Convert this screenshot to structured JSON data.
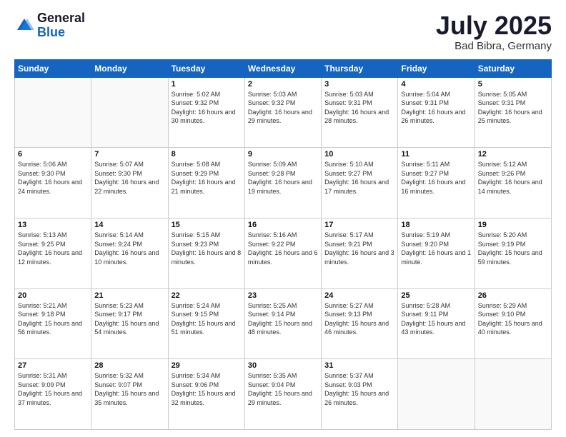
{
  "header": {
    "logo_general": "General",
    "logo_blue": "Blue",
    "main_title": "July 2025",
    "subtitle": "Bad Bibra, Germany"
  },
  "calendar": {
    "days_of_week": [
      "Sunday",
      "Monday",
      "Tuesday",
      "Wednesday",
      "Thursday",
      "Friday",
      "Saturday"
    ],
    "weeks": [
      [
        {
          "day": "",
          "info": ""
        },
        {
          "day": "",
          "info": ""
        },
        {
          "day": "1",
          "info": "Sunrise: 5:02 AM\nSunset: 9:32 PM\nDaylight: 16 hours and 30 minutes."
        },
        {
          "day": "2",
          "info": "Sunrise: 5:03 AM\nSunset: 9:32 PM\nDaylight: 16 hours and 29 minutes."
        },
        {
          "day": "3",
          "info": "Sunrise: 5:03 AM\nSunset: 9:31 PM\nDaylight: 16 hours and 28 minutes."
        },
        {
          "day": "4",
          "info": "Sunrise: 5:04 AM\nSunset: 9:31 PM\nDaylight: 16 hours and 26 minutes."
        },
        {
          "day": "5",
          "info": "Sunrise: 5:05 AM\nSunset: 9:31 PM\nDaylight: 16 hours and 25 minutes."
        }
      ],
      [
        {
          "day": "6",
          "info": "Sunrise: 5:06 AM\nSunset: 9:30 PM\nDaylight: 16 hours and 24 minutes."
        },
        {
          "day": "7",
          "info": "Sunrise: 5:07 AM\nSunset: 9:30 PM\nDaylight: 16 hours and 22 minutes."
        },
        {
          "day": "8",
          "info": "Sunrise: 5:08 AM\nSunset: 9:29 PM\nDaylight: 16 hours and 21 minutes."
        },
        {
          "day": "9",
          "info": "Sunrise: 5:09 AM\nSunset: 9:28 PM\nDaylight: 16 hours and 19 minutes."
        },
        {
          "day": "10",
          "info": "Sunrise: 5:10 AM\nSunset: 9:27 PM\nDaylight: 16 hours and 17 minutes."
        },
        {
          "day": "11",
          "info": "Sunrise: 5:11 AM\nSunset: 9:27 PM\nDaylight: 16 hours and 16 minutes."
        },
        {
          "day": "12",
          "info": "Sunrise: 5:12 AM\nSunset: 9:26 PM\nDaylight: 16 hours and 14 minutes."
        }
      ],
      [
        {
          "day": "13",
          "info": "Sunrise: 5:13 AM\nSunset: 9:25 PM\nDaylight: 16 hours and 12 minutes."
        },
        {
          "day": "14",
          "info": "Sunrise: 5:14 AM\nSunset: 9:24 PM\nDaylight: 16 hours and 10 minutes."
        },
        {
          "day": "15",
          "info": "Sunrise: 5:15 AM\nSunset: 9:23 PM\nDaylight: 16 hours and 8 minutes."
        },
        {
          "day": "16",
          "info": "Sunrise: 5:16 AM\nSunset: 9:22 PM\nDaylight: 16 hours and 6 minutes."
        },
        {
          "day": "17",
          "info": "Sunrise: 5:17 AM\nSunset: 9:21 PM\nDaylight: 16 hours and 3 minutes."
        },
        {
          "day": "18",
          "info": "Sunrise: 5:19 AM\nSunset: 9:20 PM\nDaylight: 16 hours and 1 minute."
        },
        {
          "day": "19",
          "info": "Sunrise: 5:20 AM\nSunset: 9:19 PM\nDaylight: 15 hours and 59 minutes."
        }
      ],
      [
        {
          "day": "20",
          "info": "Sunrise: 5:21 AM\nSunset: 9:18 PM\nDaylight: 15 hours and 56 minutes."
        },
        {
          "day": "21",
          "info": "Sunrise: 5:23 AM\nSunset: 9:17 PM\nDaylight: 15 hours and 54 minutes."
        },
        {
          "day": "22",
          "info": "Sunrise: 5:24 AM\nSunset: 9:15 PM\nDaylight: 15 hours and 51 minutes."
        },
        {
          "day": "23",
          "info": "Sunrise: 5:25 AM\nSunset: 9:14 PM\nDaylight: 15 hours and 48 minutes."
        },
        {
          "day": "24",
          "info": "Sunrise: 5:27 AM\nSunset: 9:13 PM\nDaylight: 15 hours and 46 minutes."
        },
        {
          "day": "25",
          "info": "Sunrise: 5:28 AM\nSunset: 9:11 PM\nDaylight: 15 hours and 43 minutes."
        },
        {
          "day": "26",
          "info": "Sunrise: 5:29 AM\nSunset: 9:10 PM\nDaylight: 15 hours and 40 minutes."
        }
      ],
      [
        {
          "day": "27",
          "info": "Sunrise: 5:31 AM\nSunset: 9:09 PM\nDaylight: 15 hours and 37 minutes."
        },
        {
          "day": "28",
          "info": "Sunrise: 5:32 AM\nSunset: 9:07 PM\nDaylight: 15 hours and 35 minutes."
        },
        {
          "day": "29",
          "info": "Sunrise: 5:34 AM\nSunset: 9:06 PM\nDaylight: 15 hours and 32 minutes."
        },
        {
          "day": "30",
          "info": "Sunrise: 5:35 AM\nSunset: 9:04 PM\nDaylight: 15 hours and 29 minutes."
        },
        {
          "day": "31",
          "info": "Sunrise: 5:37 AM\nSunset: 9:03 PM\nDaylight: 15 hours and 26 minutes."
        },
        {
          "day": "",
          "info": ""
        },
        {
          "day": "",
          "info": ""
        }
      ]
    ]
  }
}
